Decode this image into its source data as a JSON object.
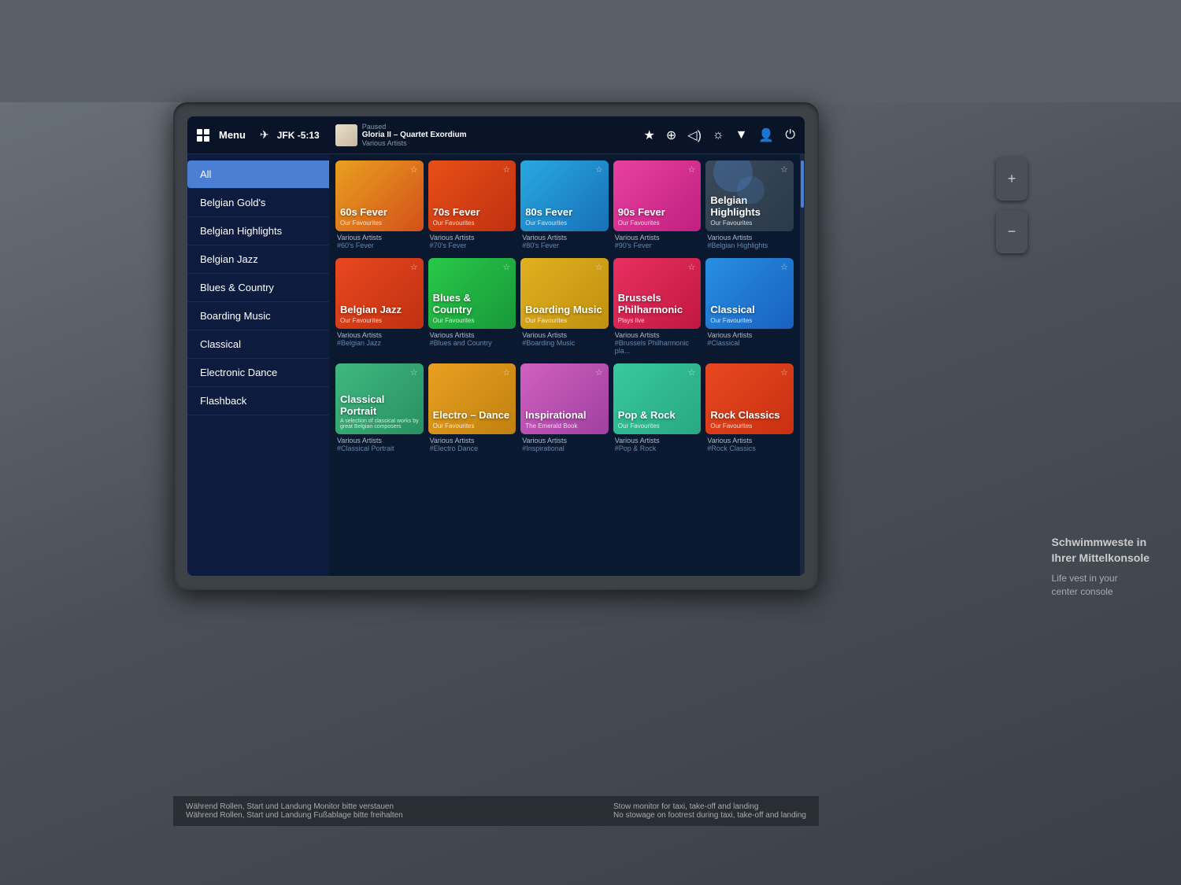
{
  "topbar": {
    "menu_label": "Menu",
    "flight": "JFK -5:13",
    "paused": "Paused",
    "track_title": "Gloria II – Quartet Exordium",
    "track_artist": "Various Artists",
    "icons": [
      "★",
      "🌐",
      "🔊",
      "☀",
      "🌡",
      "👤",
      "⏻"
    ]
  },
  "sidebar": {
    "active": "All",
    "items": [
      {
        "label": "All"
      },
      {
        "label": "Belgian Gold's"
      },
      {
        "label": "Belgian Highlights"
      },
      {
        "label": "Belgian Jazz"
      },
      {
        "label": "Blues & Country"
      },
      {
        "label": "Boarding Music"
      },
      {
        "label": "Classical"
      },
      {
        "label": "Electronic Dance"
      },
      {
        "label": "Flashback"
      }
    ]
  },
  "grid": {
    "rows": [
      [
        {
          "title": "60s Fever",
          "sub": "Our Favourites",
          "artist": "Various Artists",
          "tag": "#60's Fever",
          "color1": "#e8a020",
          "color2": "#d4501a"
        },
        {
          "title": "70s Fever",
          "sub": "Our Favourites",
          "artist": "Various Artists",
          "tag": "#70's Fever",
          "color1": "#e85018",
          "color2": "#c03010"
        },
        {
          "title": "80s Fever",
          "sub": "Our Favourites",
          "artist": "Various Artists",
          "tag": "#80's Fever",
          "color1": "#28a8e0",
          "color2": "#1870b8"
        },
        {
          "title": "90s Fever",
          "sub": "Our Favourites",
          "artist": "Various Artists",
          "tag": "#90's Fever",
          "color1": "#e840a0",
          "color2": "#c02080"
        },
        {
          "title": "Belgian Highlights",
          "sub": "Our Favourites",
          "artist": "Various Artists",
          "tag": "#Belgian Highlights",
          "color1": "#3a4a5a",
          "color2": "#2a3a4a"
        }
      ],
      [
        {
          "title": "Belgian Jazz",
          "sub": "Our Favourites",
          "artist": "Various Artists",
          "tag": "#Belgian Jazz",
          "color1": "#e84820",
          "color2": "#c03010"
        },
        {
          "title": "Blues & Country",
          "sub": "Our Favourites",
          "artist": "Various Artists",
          "tag": "#Blues and Country",
          "color1": "#28c848",
          "color2": "#18983a"
        },
        {
          "title": "Boarding Music",
          "sub": "Our Favourites",
          "artist": "Various Artists",
          "tag": "#Boarding Music",
          "color1": "#e0b020",
          "color2": "#c09010"
        },
        {
          "title": "Brussels Philharmonic",
          "sub": "Plays live",
          "artist": "Various Artists",
          "tag": "#Brussels Philharmonic pla...",
          "color1": "#e83060",
          "color2": "#c01840"
        },
        {
          "title": "Classical",
          "sub": "Our Favourites",
          "artist": "Various Artists",
          "tag": "#Classical",
          "color1": "#2890e0",
          "color2": "#1860c0"
        }
      ],
      [
        {
          "title": "Classical Portrait",
          "sub": "A selection of classical works by great Belgian composers",
          "artist": "Various Artists",
          "tag": "#Classical Portrait",
          "color1": "#40b880",
          "color2": "#289060"
        },
        {
          "title": "Electro – Dance",
          "sub": "Our Favourites",
          "artist": "Various Artists",
          "tag": "#Electro Dance",
          "color1": "#e8a020",
          "color2": "#c08010"
        },
        {
          "title": "Inspirational",
          "sub": "The Emerald Book",
          "artist": "Various Artists",
          "tag": "#Inspirational",
          "color1": "#d060c0",
          "color2": "#a040a0"
        },
        {
          "title": "Pop & Rock",
          "sub": "Our Favourites",
          "artist": "Various Artists",
          "tag": "#Pop & Rock",
          "color1": "#38c8a0",
          "color2": "#28a880"
        },
        {
          "title": "Rock Classics",
          "sub": "Our Favourites",
          "artist": "Various Artists",
          "tag": "#Rock Classics",
          "color1": "#e84820",
          "color2": "#c83010"
        }
      ]
    ]
  },
  "bottom_bar": {
    "text_left_de": "Während Rollen, Start und Landung Monitor bitte verstauen",
    "text_left_de2": "Während Rollen, Start und Landung Fußablage bitte freihalten",
    "text_right_en": "Stow monitor for taxi, take-off and landing",
    "text_right_en2": "No stowage on footrest during taxi, take-off and landing"
  },
  "right_panel": {
    "label1": "Schwimmweste in",
    "label2": "Ihrer Mittelkonsole",
    "label3": "Life vest in your",
    "label4": "center console"
  }
}
